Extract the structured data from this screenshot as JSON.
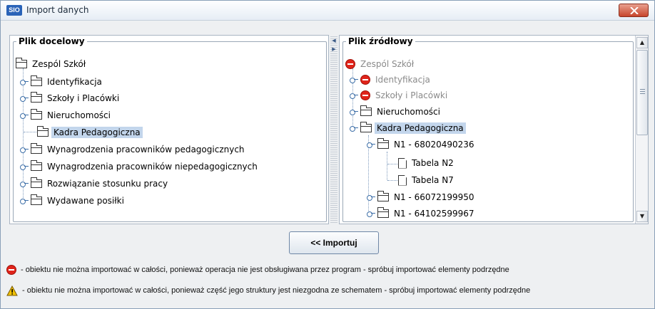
{
  "window": {
    "app_icon_text": "SIO",
    "title": "Import danych"
  },
  "left_panel": {
    "legend": "Plik docelowy",
    "root": "Zespól Szkół",
    "items": [
      "Identyfikacja",
      "Szkoły i Placówki",
      "Nieruchomości",
      "Kadra Pedagogiczna",
      "Wynagrodzenia pracowników pedagogicznych",
      "Wynagrodzenia pracowników niepedagogicznych",
      "Rozwiązanie stosunku pracy",
      "Wydawane posiłki"
    ],
    "selected": "Kadra Pedagogiczna"
  },
  "right_panel": {
    "legend": "Plik źródłowy",
    "root": "Zespól Szkół",
    "items": [
      "Identyfikacja",
      "Szkoły i Placówki",
      "Nieruchomości",
      "Kadra Pedagogiczna",
      "N1 - 68020490236",
      "Tabela N2",
      "Tabela N7",
      "N1 - 66072199950",
      "N1 - 64102599967"
    ],
    "selected": "Kadra Pedagogiczna"
  },
  "buttons": {
    "import": "<< Importuj"
  },
  "legend_notes": {
    "noentry": "- obiektu nie można importować w całości, ponieważ operacja nie jest obsługiwana przez program - spróbuj importować elementy podrzędne",
    "warning": "- obiektu nie można importować w całości, ponieważ część jego struktury jest niezgodna ze schematem - spróbuj importować elementy podrzędne"
  },
  "colors": {
    "selection": "#c3d6ec",
    "noentry": "#e0241b",
    "warning": "#f2c200",
    "close_button": "#c7452c"
  },
  "icons": {
    "noentry": "no-entry-icon",
    "warning": "warning-icon",
    "folder": "folder-icon",
    "document": "document-icon"
  }
}
